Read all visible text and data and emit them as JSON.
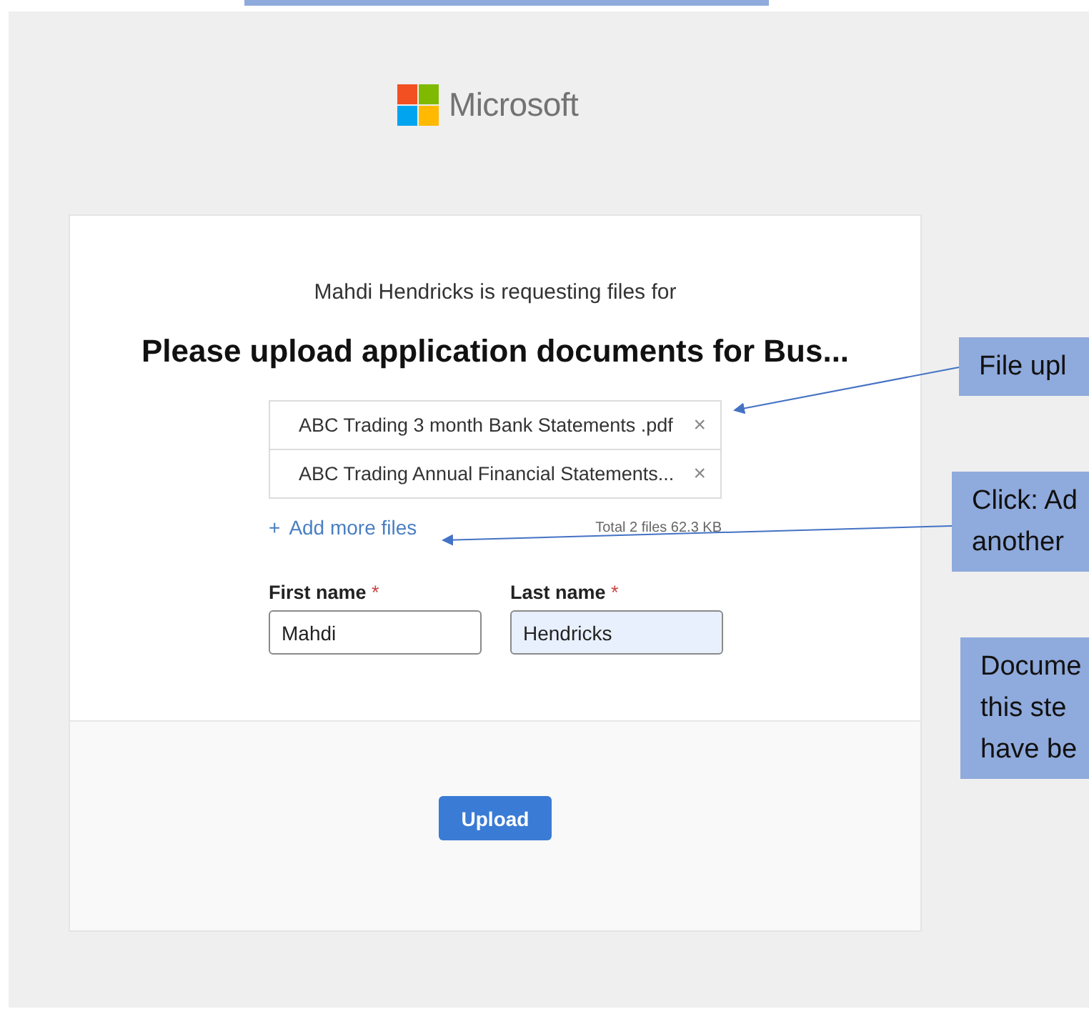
{
  "logo": {
    "text": "Microsoft"
  },
  "request": {
    "requester": "Mahdi Hendricks is requesting files for",
    "title": "Please upload application documents for Bus..."
  },
  "files": [
    {
      "name": "ABC Trading 3 month Bank Statements .pdf",
      "remove": "×"
    },
    {
      "name": "ABC Trading Annual Financial Statements...",
      "remove": "×"
    }
  ],
  "add_files": {
    "icon": "+",
    "label": "Add more files"
  },
  "total": "Total 2 files  62.3 KB",
  "fields": [
    {
      "label": "First name",
      "required_mark": "*",
      "value": "Mahdi",
      "highlighted": false
    },
    {
      "label": "Last name",
      "required_mark": "*",
      "value": "Hendricks",
      "highlighted": true
    }
  ],
  "button": "Upload",
  "callouts": [
    {
      "lines": [
        "File upl"
      ]
    },
    {
      "lines": [
        "Click: Ad",
        "another"
      ]
    },
    {
      "lines": [
        "Docume",
        "this ste",
        "have be"
      ]
    }
  ]
}
